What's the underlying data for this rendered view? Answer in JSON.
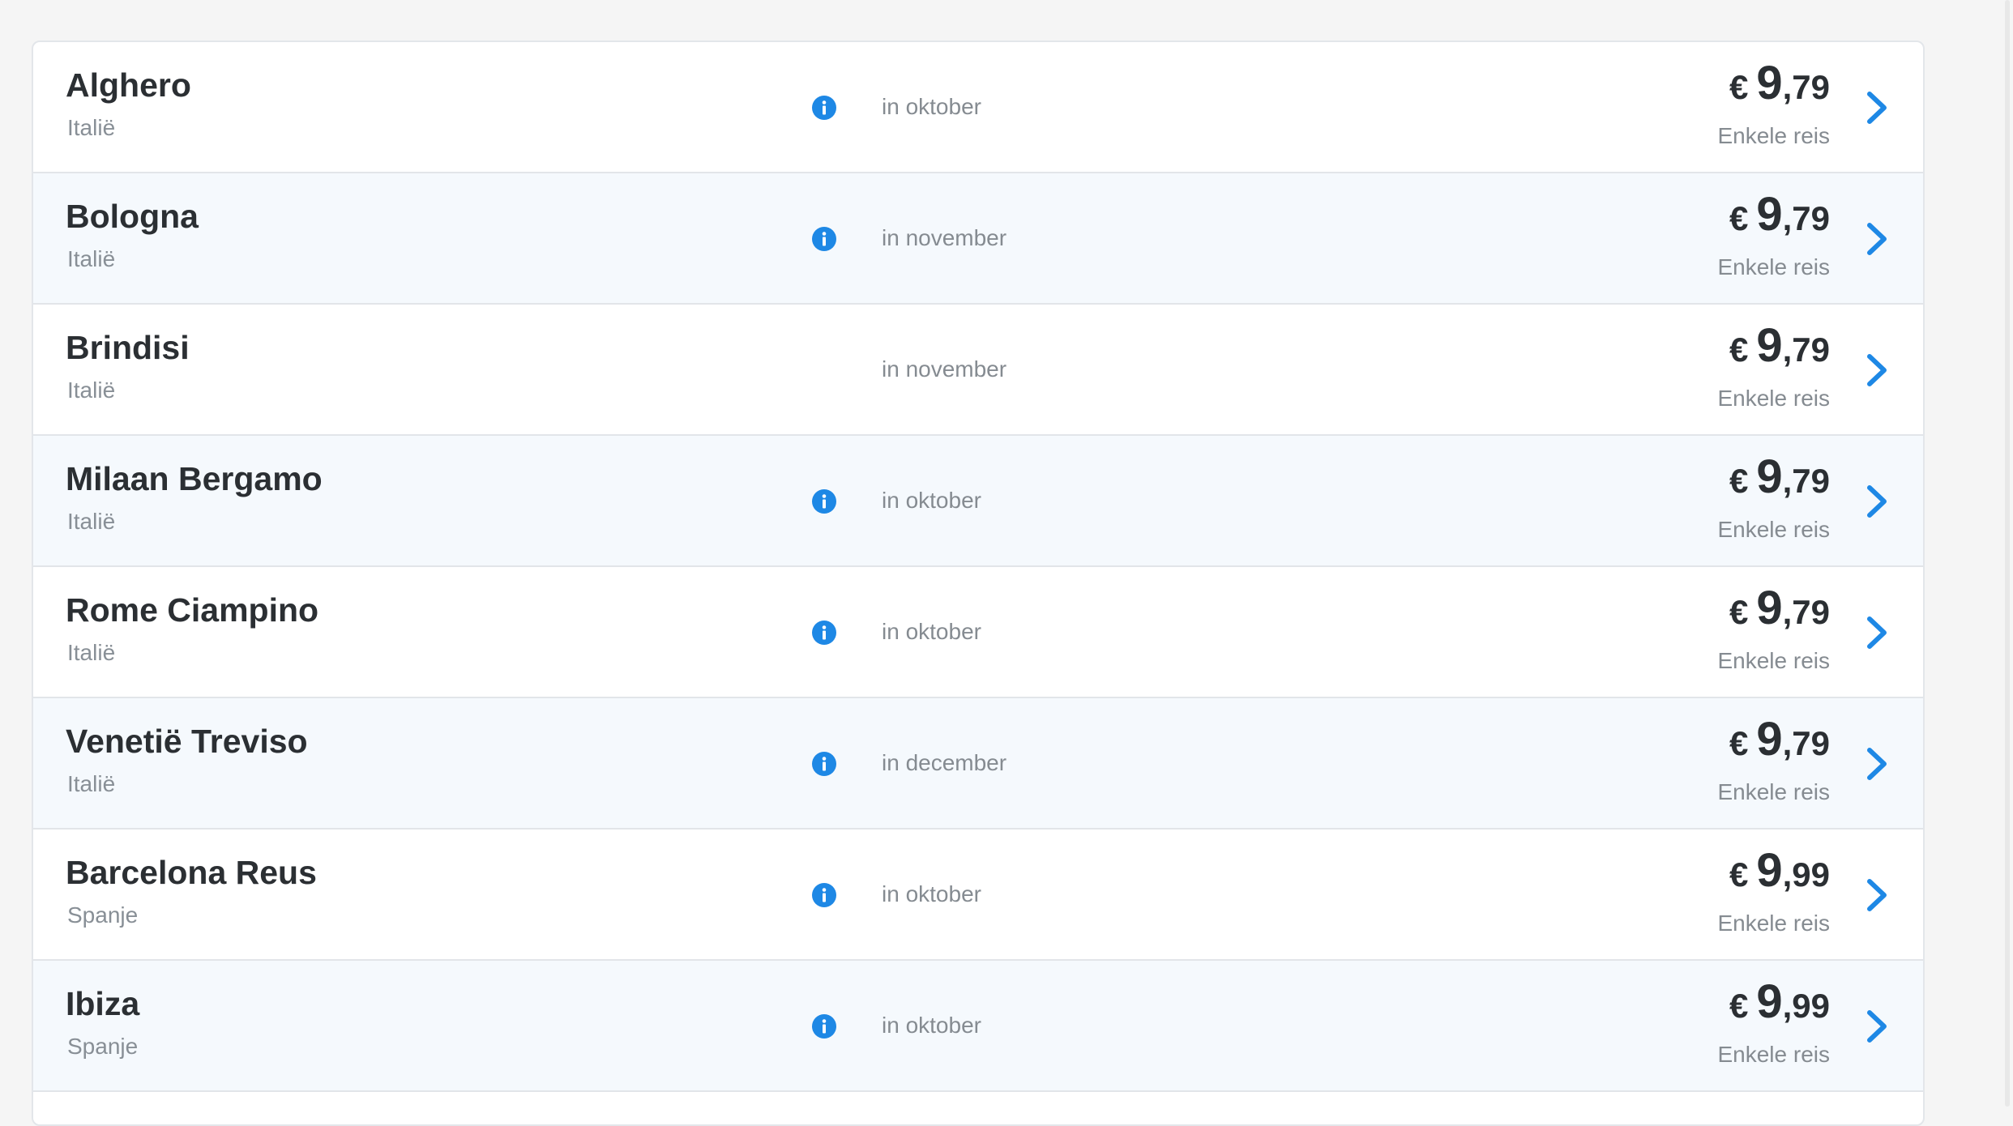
{
  "currency": "€",
  "decimal_separator": ",",
  "accent_color": "#1e88e5",
  "icons": {
    "info": "info-icon",
    "chevron": "chevron-right-icon"
  },
  "rows": [
    {
      "name": "Alghero",
      "country": "Italië",
      "has_info": true,
      "month": "in oktober",
      "price_int": "9",
      "price_dec": "79",
      "trip": "Enkele reis"
    },
    {
      "name": "Bologna",
      "country": "Italië",
      "has_info": true,
      "month": "in november",
      "price_int": "9",
      "price_dec": "79",
      "trip": "Enkele reis"
    },
    {
      "name": "Brindisi",
      "country": "Italië",
      "has_info": false,
      "month": "in november",
      "price_int": "9",
      "price_dec": "79",
      "trip": "Enkele reis"
    },
    {
      "name": "Milaan Bergamo",
      "country": "Italië",
      "has_info": true,
      "month": "in oktober",
      "price_int": "9",
      "price_dec": "79",
      "trip": "Enkele reis"
    },
    {
      "name": "Rome Ciampino",
      "country": "Italië",
      "has_info": true,
      "month": "in oktober",
      "price_int": "9",
      "price_dec": "79",
      "trip": "Enkele reis"
    },
    {
      "name": "Venetië Treviso",
      "country": "Italië",
      "has_info": true,
      "month": "in december",
      "price_int": "9",
      "price_dec": "79",
      "trip": "Enkele reis"
    },
    {
      "name": "Barcelona Reus",
      "country": "Spanje",
      "has_info": true,
      "month": "in oktober",
      "price_int": "9",
      "price_dec": "99",
      "trip": "Enkele reis"
    },
    {
      "name": "Ibiza",
      "country": "Spanje",
      "has_info": true,
      "month": "in oktober",
      "price_int": "9",
      "price_dec": "99",
      "trip": "Enkele reis"
    }
  ]
}
